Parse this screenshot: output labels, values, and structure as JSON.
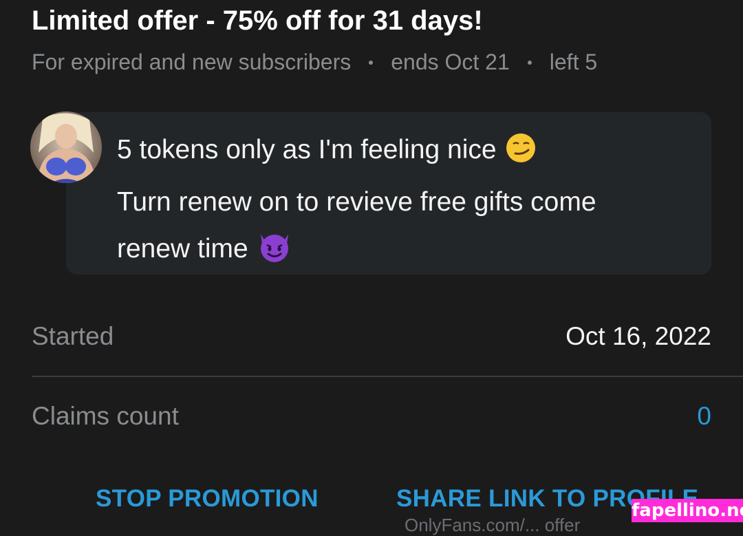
{
  "offer": {
    "title": "Limited offer - 75% off for 31 days!",
    "audience": "For expired and new subscribers",
    "ends": "ends Oct 21",
    "left": "left 5"
  },
  "message": {
    "line1": "5 tokens only as I'm feeling nice",
    "line2": "Turn renew on to revieve free gifts come",
    "line3": "renew time",
    "emoji1": "smirking-face",
    "emoji2": "smiling-devil"
  },
  "details": {
    "started_label": "Started",
    "started_value": "Oct 16, 2022",
    "claims_label": "Claims count",
    "claims_value": "0"
  },
  "actions": {
    "stop_label": "STOP PROMOTION",
    "share_label": "SHARE LINK TO PROFILE",
    "share_sub": "OnlyFans.com/...  offer"
  },
  "colors": {
    "background": "#1b1b1c",
    "bubble": "#232628",
    "accent": "#2a9ad8",
    "muted": "#8a8d90"
  },
  "watermark": "fapellino.net"
}
